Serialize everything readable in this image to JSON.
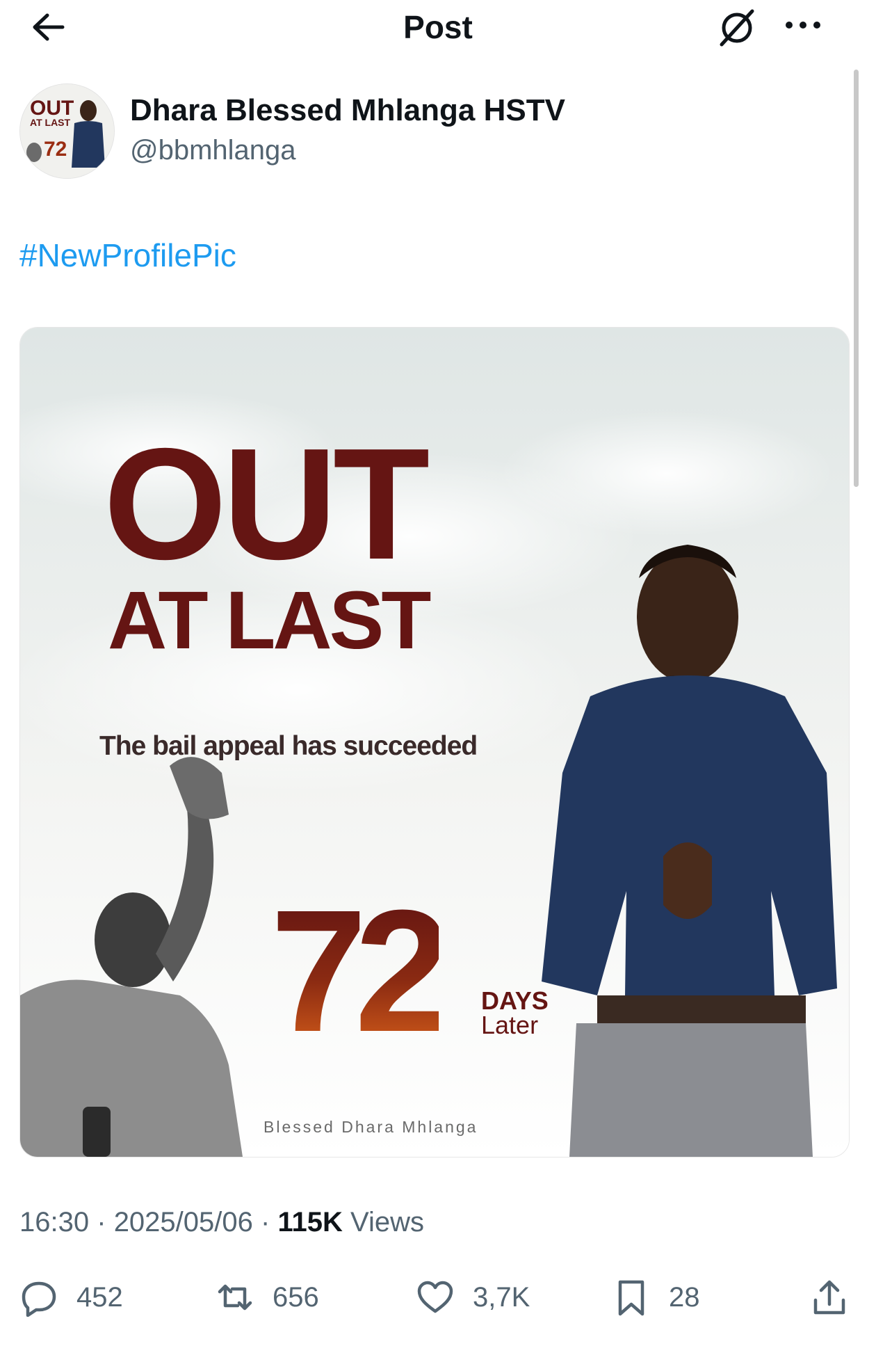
{
  "header": {
    "title": "Post",
    "back_icon": "arrow-left-icon",
    "grok_icon": "grok-icon",
    "more_icon": "more-horizontal-icon"
  },
  "author": {
    "display_name": "Dhara Blessed Mhlanga HSTV",
    "handle": "@bbmhlanga",
    "avatar_text": {
      "line1": "OUT",
      "line2": "AT LAST",
      "number": "72"
    }
  },
  "post": {
    "hashtag": "#NewProfilePic",
    "image": {
      "headline1": "OUT",
      "headline2": "AT LAST",
      "subtitle": "The bail appeal has succeeded",
      "number": "72",
      "days_word": "DAYS",
      "later_word": "Later",
      "signature": "Blessed Dhara Mhlanga"
    },
    "time": "16:30",
    "date": "2025/05/06",
    "separator": "·",
    "views_count": "115K",
    "views_label": "Views"
  },
  "actions": {
    "replies": "452",
    "reposts": "656",
    "likes": "3,7K",
    "bookmarks": "28"
  },
  "colors": {
    "link": "#1d9bf0",
    "secondary_text": "#536471",
    "poster_maroon": "#651513"
  }
}
